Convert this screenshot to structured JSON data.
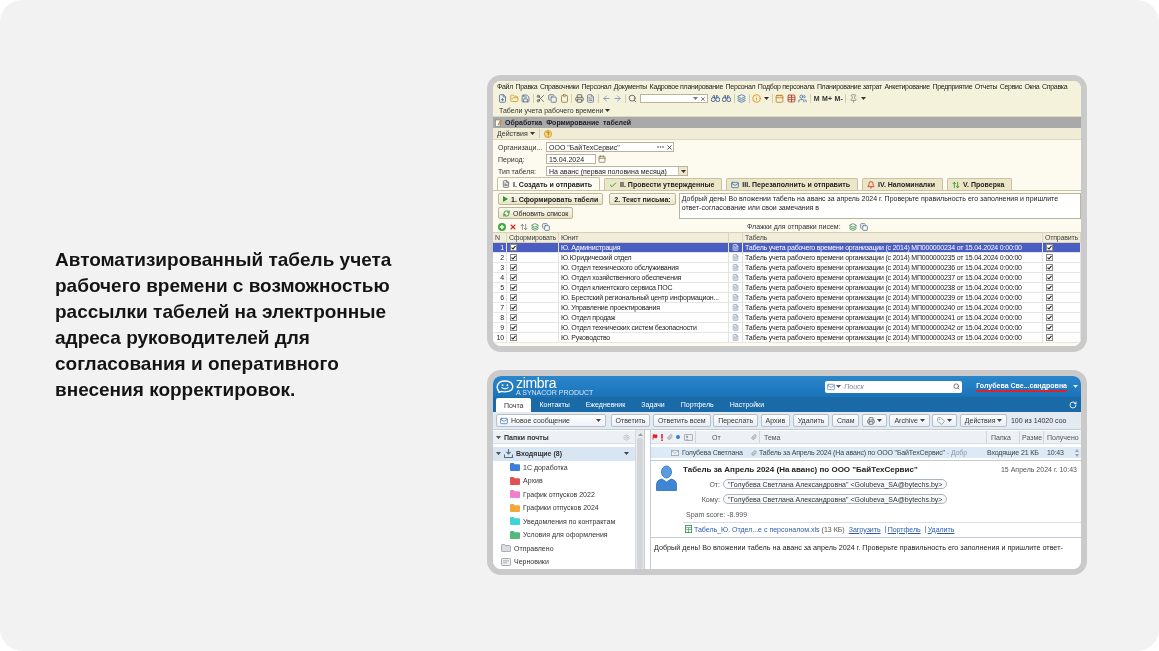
{
  "caption": "Автоматизированный табель учета рабочего времени с возможностью рассылки табелей на электронные адреса руководителей для согласования и оперативного внесения корректировок.",
  "timesheet_app": {
    "menu": [
      "Файл",
      "Правка",
      "Справочники",
      "Персонал",
      "Документы",
      "Кадровое планирование",
      "Персонал",
      "Подбор персонала",
      "Планирование затрат",
      "Анкетирование",
      "Предприятие",
      "Отчеты",
      "Сервис",
      "Окна",
      "Справка"
    ],
    "memory_buttons": [
      "M",
      "M+",
      "M-"
    ],
    "panel_tab": "Табели учета рабочего времени",
    "window_title": "Обработка Формирование табелей",
    "actions_menu": "Действия",
    "fields": [
      {
        "kind": "reference",
        "label": "Организаци...",
        "value": "ООО \"БайТехСервис\""
      },
      {
        "kind": "date",
        "label": "Период:",
        "value": "15.04.2024"
      },
      {
        "kind": "choice",
        "label": "Тип табеля:",
        "value": "На аванс (первая половина месяца)"
      }
    ],
    "tabs": [
      {
        "label": "I. Создать и отправить",
        "selected": true
      },
      {
        "label": "II. Провести утвержденные",
        "selected": false
      },
      {
        "label": "III. Перезаполнить и отправить",
        "selected": false
      },
      {
        "label": "IV. Напоминалки",
        "selected": false
      },
      {
        "label": "V. Проверка",
        "selected": false
      }
    ],
    "generate_button": "1. Сформировать табели",
    "letter_button": "2. Текст письма:",
    "letter_text": "Добрый день! Во вложении табель на аванс за апрель 2024 г. Проверьте правильность его заполнения и пришлите ответ-согласование или свои замечания в",
    "refresh_button": "Обновить список",
    "flags_label": "Флажки для отправки писем:",
    "table": {
      "columns": [
        "N",
        "Сформировать",
        "Юнит",
        "Табель",
        "Отправить"
      ],
      "rows": [
        {
          "n": "1",
          "generate": true,
          "unit": "Ю. Администрация",
          "timesheet": "Табель учета рабочего времени организации (с 2014) МП000000234 от 15.04.2024 0:00:00",
          "send": true,
          "selected": true
        },
        {
          "n": "2",
          "generate": true,
          "unit": "Ю.Юридический отдел",
          "timesheet": "Табель учета рабочего времени организации (с 2014) МП000000235 от 15.04.2024 0:00:00",
          "send": true,
          "selected": false
        },
        {
          "n": "3",
          "generate": true,
          "unit": "Ю. Отдел технического обслуживания",
          "timesheet": "Табель учета рабочего времени организации (с 2014) МП000000236 от 15.04.2024 0:00:00",
          "send": true,
          "selected": false
        },
        {
          "n": "4",
          "generate": true,
          "unit": "Ю. Отдел хозяйственного обеспечения",
          "timesheet": "Табель учета рабочего времени организации (с 2014) МП000000237 от 15.04.2024 0:00:00",
          "send": true,
          "selected": false
        },
        {
          "n": "5",
          "generate": true,
          "unit": "Ю. Отдел клиентского сервиса ПОС",
          "timesheet": "Табель учета рабочего времени организации (с 2014) МП000000238 от 15.04.2024 0:00:00",
          "send": true,
          "selected": false
        },
        {
          "n": "6",
          "generate": true,
          "unit": "Ю. Брестский региональный центр информацион...",
          "timesheet": "Табель учета рабочего времени организации (с 2014) МП000000239 от 15.04.2024 0:00:00",
          "send": true,
          "selected": false
        },
        {
          "n": "7",
          "generate": true,
          "unit": "Ю. Управление проектирования",
          "timesheet": "Табель учета рабочего времени организации (с 2014) МП000000240 от 15.04.2024 0:00:00",
          "send": true,
          "selected": false
        },
        {
          "n": "8",
          "generate": true,
          "unit": "Ю. Отдел продаж",
          "timesheet": "Табель учета рабочего времени организации (с 2014) МП000000241 от 15.04.2024 0:00:00",
          "send": true,
          "selected": false
        },
        {
          "n": "9",
          "generate": true,
          "unit": "Ю. Отдел технических систем безопасности",
          "timesheet": "Табель учета рабочего времени организации (с 2014) МП000000242 от 15.04.2024 0:00:00",
          "send": true,
          "selected": false
        },
        {
          "n": "10",
          "generate": true,
          "unit": "Ю. Руководство",
          "timesheet": "Табель учета рабочего времени организации (с 2014) МП000000243 от 15.04.2024 0:00:00",
          "send": true,
          "selected": false
        }
      ]
    }
  },
  "mail_app": {
    "logo": {
      "name": "zimbra",
      "tagline": "A SYNACOR PRODUCT"
    },
    "search": {
      "placeholder": "Поиск"
    },
    "user": "Голубева Све...сандровна",
    "tabs": [
      {
        "label": "Почта",
        "selected": true
      },
      {
        "label": "Контакты",
        "selected": false
      },
      {
        "label": "Ежедневник",
        "selected": false
      },
      {
        "label": "Задачи",
        "selected": false
      },
      {
        "label": "Портфель",
        "selected": false
      },
      {
        "label": "Настройки",
        "selected": false
      }
    ],
    "new_message": "Новое сообщение",
    "toolbar": [
      {
        "kind": "button",
        "label": "Ответить"
      },
      {
        "kind": "button",
        "label": "Ответить всем"
      },
      {
        "kind": "button",
        "label": "Переслать"
      },
      {
        "kind": "button",
        "label": "Архив"
      },
      {
        "kind": "button",
        "label": "Удалить"
      },
      {
        "kind": "button",
        "label": "Спам"
      },
      {
        "kind": "print"
      },
      {
        "kind": "menu",
        "label": "Archive"
      },
      {
        "kind": "tag"
      },
      {
        "kind": "menu",
        "label": "Действия"
      }
    ],
    "message_count": "100 из 14020 соо",
    "folders_header": {
      "label": "Папки почты",
      "expanded": true
    },
    "folders": [
      {
        "kind": "inbox",
        "name": "Входящие (8)",
        "selected": true,
        "expanded": true,
        "children": [
          {
            "name": "1С доработка",
            "color": "#3d7fd6",
            "selected": false
          },
          {
            "name": "Архив",
            "color": "#e05252",
            "selected": false
          },
          {
            "name": "График отпусков 2022",
            "color": "#ee7fcc",
            "selected": false
          },
          {
            "name": "Графики отпусков 2024",
            "color": "#f2a93b",
            "selected": false
          },
          {
            "name": "Уведомления по контрактам",
            "color": "#41d3d6",
            "selected": false
          },
          {
            "name": "Условия для оформления",
            "color": "#52b87e",
            "selected": false
          }
        ]
      },
      {
        "kind": "sent",
        "name": "Отправлено",
        "selected": false
      },
      {
        "kind": "drafts",
        "name": "Черновики",
        "selected": false
      }
    ],
    "list_columns": [
      "От",
      "Тема",
      "Папка",
      "Разме",
      "Получено"
    ],
    "messages": [
      {
        "from": "Голубева Светлана",
        "subject": "Табель за Апрель 2024 (На аванс) по ООО \"БайТехСервис\"",
        "preview": "- Добр",
        "folder": "Входящие",
        "size": "21 КБ",
        "time": "10:43",
        "selected": true
      }
    ],
    "reading": {
      "subject": "Табель за Апрель 2024 (На аванс) по ООО \"БайТехСервис\"",
      "date": "15 Апрель 2024 г. 10:43",
      "from_label": "От:",
      "from": "\"Голубева Светлана Александровна\" <Golubeva_SA@bytechs.by>",
      "to_label": "Кому:",
      "to": "\"Голубева Светлана Александровна\" <Golubeva_SA@bytechs.by>",
      "spam_score": "Spam score: -8.999",
      "attachment": {
        "name": "Табель_Ю. Отдел...е с персоналом.xls",
        "size": "(13 КБ)",
        "actions": [
          "Загрузить",
          "Портфель",
          "Удалить"
        ]
      },
      "body": "Добрый день! Во вложении табель на аванс за апрель 2024 г. Проверьте правильность его заполнения и пришлите ответ-"
    }
  }
}
